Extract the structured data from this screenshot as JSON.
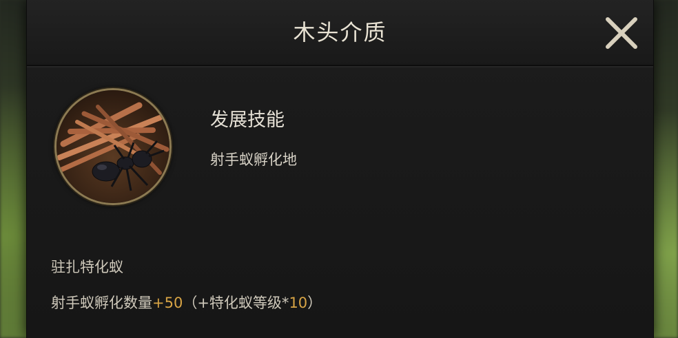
{
  "dialog": {
    "title": "木头介质",
    "close_icon": "close-icon"
  },
  "item": {
    "image_icon": "wood-pile-ant-icon",
    "skill_label": "发展技能",
    "skill_value": "射手蚁孵化地"
  },
  "bonus": {
    "section_title": "驻扎特化蚁",
    "effect_prefix": "射手蚁孵化数量",
    "effect_value": "+50",
    "effect_mid": "（+特化蚁等级*",
    "effect_multiplier": "10",
    "effect_suffix": "）"
  },
  "colors": {
    "highlight": "#d9a545",
    "title": "#e9e3d4",
    "panel": "#1a1a1a",
    "frame": "#8c7a52"
  }
}
